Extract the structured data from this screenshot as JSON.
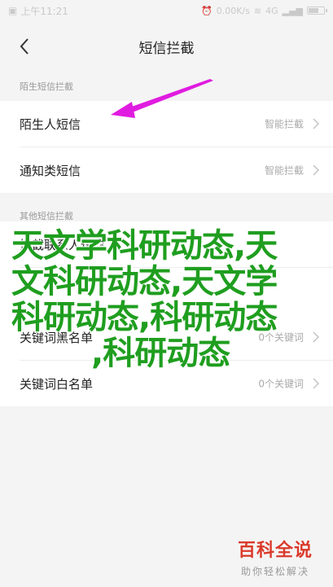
{
  "status_bar": {
    "time": "上午11:21",
    "speed": "0.00K/s",
    "network": "4G"
  },
  "header": {
    "title": "短信拦截"
  },
  "sections": [
    {
      "label": "陌生短信拦截",
      "rows": [
        {
          "label": "陌生人短信",
          "value": "智能拦截"
        },
        {
          "label": "通知类短信",
          "value": "智能拦截"
        }
      ]
    },
    {
      "label": "其他短信拦截",
      "rows": [
        {
          "label": "拦截联系人短信",
          "value": ""
        },
        {
          "label": "关键词黑名单",
          "value": "0个关键词"
        },
        {
          "label": "关键词白名单",
          "value": "0个关键词"
        }
      ]
    }
  ],
  "overlay": {
    "lines": [
      "天文学科研动态,天",
      "文科研动态,天文学",
      "科研动态,科研动态",
      ",科研动态"
    ]
  },
  "watermark": {
    "title": "百科全说",
    "subtitle": "助你轻松解决"
  },
  "colors": {
    "overlay_text": "#1f9e1f",
    "arrow": "#e01ce0",
    "watermark": "#d93a2b"
  }
}
